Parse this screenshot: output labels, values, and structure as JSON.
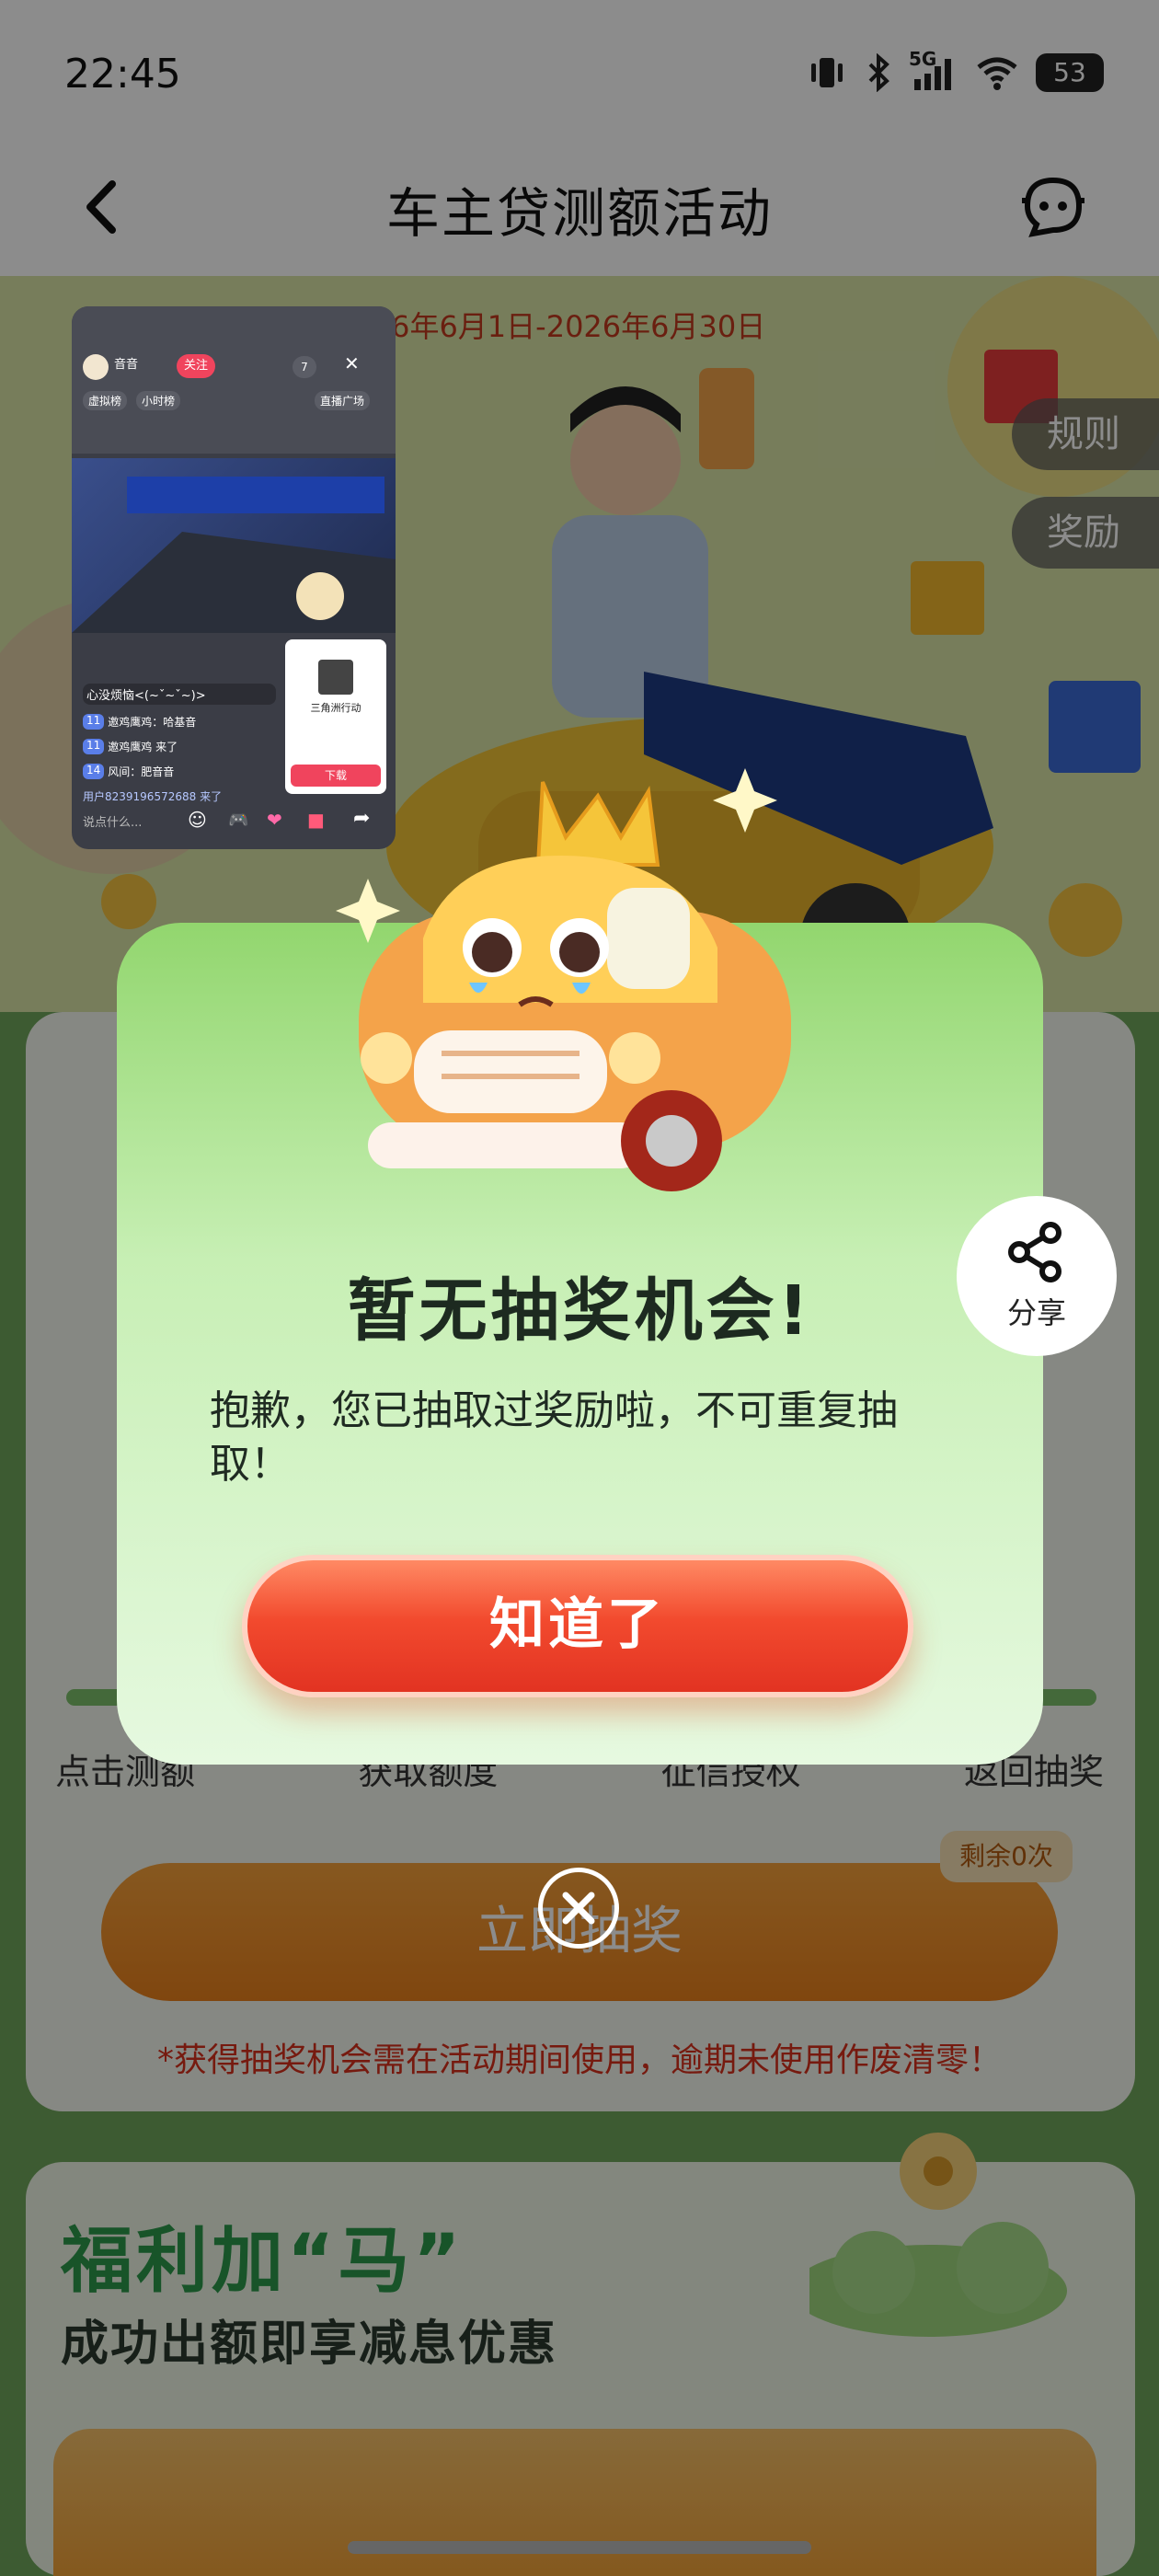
{
  "status_bar": {
    "time": "22:45",
    "network": "5G",
    "battery": "53"
  },
  "nav": {
    "title": "车主贷测额活动"
  },
  "hero": {
    "period": "间：2026年6月1日-2026年6月30日"
  },
  "side_buttons": {
    "rules": "规则",
    "prizes": "奖励"
  },
  "steps": [
    "点击测额",
    "获取额度",
    "征信授权",
    "返回抽奖"
  ],
  "draw": {
    "button": "立即抽奖",
    "remain": "剩余0次"
  },
  "note": "*获得抽奖机会需在活动期间使用，逾期未使用作废清零！",
  "welfare": {
    "title": "福利加“马”",
    "subtitle": "成功出额即享减息优惠"
  },
  "pip": {
    "host": "音音",
    "follow": "关注",
    "viewer_count": "7",
    "tags": [
      "虚拟榜",
      "小时榜"
    ],
    "plaza": "直播广场",
    "comments": [
      {
        "text": "心没烦恼<(~ˇ~ˇ~)>"
      },
      {
        "badge": "11",
        "text": "邀鸡鹰鸡：哈基音"
      },
      {
        "badge": "11",
        "text": "邀鸡鹰鸡 来了"
      },
      {
        "badge": "14",
        "text": "风间：肥音音"
      },
      {
        "text": "用户8239196572688 来了"
      }
    ],
    "ad_title": "三角洲行动",
    "ad_button": "下载",
    "input_placeholder": "说点什么..."
  },
  "dialog": {
    "title": "暂无抽奖机会!",
    "message": "抱歉，您已抽取过奖励啦，不可重复抽取！",
    "ok_button": "知道了"
  },
  "share": {
    "label": "分享"
  },
  "colors": {
    "accent_red": "#e23322",
    "brand_green": "#2c9a4b",
    "note_red": "#d8311c"
  }
}
